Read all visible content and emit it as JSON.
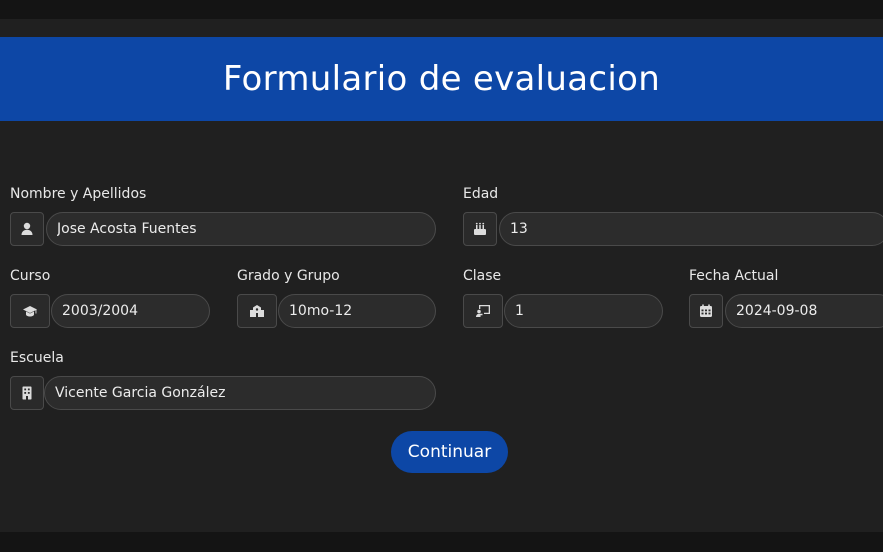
{
  "header": {
    "title": "Formulario de evaluacion"
  },
  "form": {
    "nombre": {
      "label": "Nombre y Apellidos",
      "value": "Jose Acosta Fuentes",
      "icon": "user-icon"
    },
    "edad": {
      "label": "Edad",
      "value": "13",
      "icon": "birthday-cake-icon"
    },
    "curso": {
      "label": "Curso",
      "value": "2003/2004",
      "icon": "graduation-cap-icon"
    },
    "grado": {
      "label": "Grado y Grupo",
      "value": "10mo-12",
      "icon": "school-icon"
    },
    "clase": {
      "label": "Clase",
      "value": "1",
      "icon": "chalkboard-teacher-icon"
    },
    "fecha": {
      "label": "Fecha Actual",
      "value": "2024-09-08",
      "icon": "calendar-icon"
    },
    "escuela": {
      "label": "Escuela",
      "value": "Vicente Garcia González",
      "icon": "building-icon"
    }
  },
  "actions": {
    "continue_label": "Continuar"
  },
  "colors": {
    "accent": "#0d47a6",
    "background": "#202020",
    "input_bg": "#2c2c2c"
  }
}
